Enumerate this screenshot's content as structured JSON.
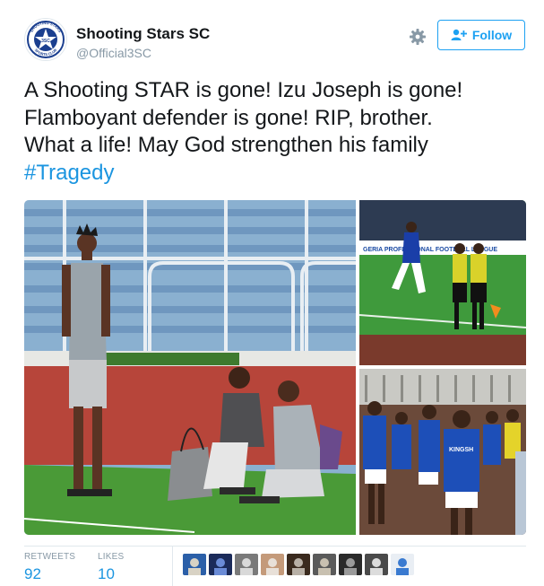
{
  "account": {
    "name": "Shooting Stars SC",
    "handle": "@Official3SC",
    "logo_text": "3SC",
    "logo_ring_top": "SHOOTING STARS",
    "logo_ring_bottom": "SPORTS CLUB",
    "brand_color": "#1b3f8f"
  },
  "actions": {
    "settings_icon": "gear-icon",
    "follow_icon": "add-user-icon",
    "follow_label": "Follow"
  },
  "tweet": {
    "line1": "A Shooting STAR is gone! Izu Joseph is gone!",
    "line2": "Flamboyant defender is gone! RIP, brother.",
    "line3": "What a life! May God strengthen his family",
    "hashtag": "#Tragedy"
  },
  "media": {
    "photos": [
      "stadium-photo",
      "match-photo",
      "celebration-photo"
    ],
    "ad_board_text": "GERIA PROFESSIONAL FOOTBALL LEAGUE",
    "shirt_text": "KINGSH"
  },
  "stats": {
    "retweets_label": "RETWEETS",
    "retweets_value": "92",
    "likes_label": "LIKES",
    "likes_value": "10",
    "liker_count": 9
  },
  "colors": {
    "link": "#1b95e0",
    "follow": "#1da1f2",
    "muted": "#8899a6",
    "border": "#e1e8ed"
  }
}
